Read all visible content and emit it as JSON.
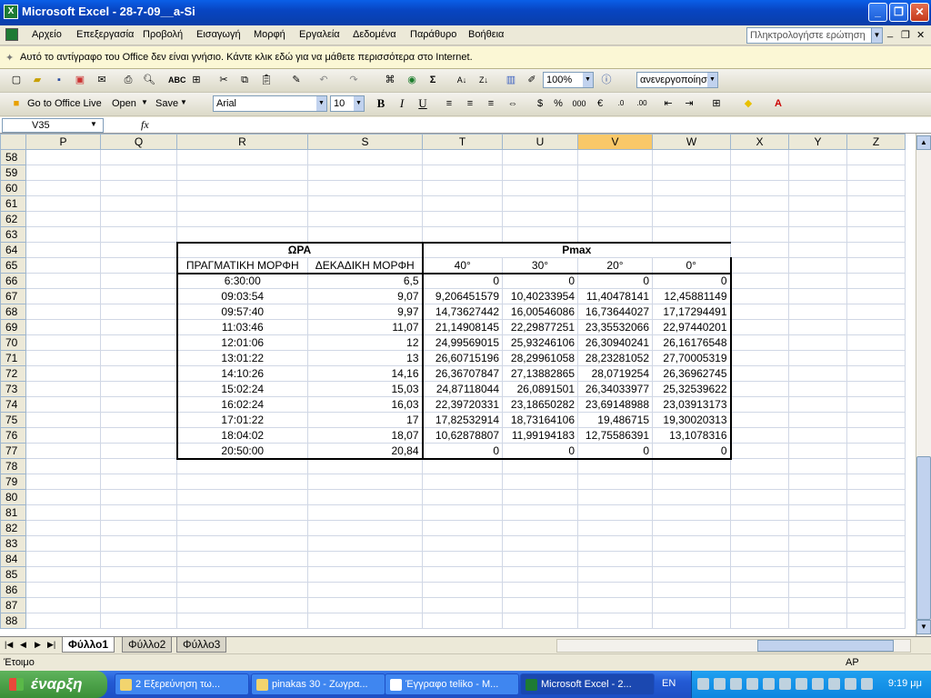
{
  "window": {
    "title": "Microsoft Excel - 28-7-09__a-Si",
    "app_icon": "excel-icon"
  },
  "menu": {
    "items": [
      "Αρχείο",
      "Επεξεργασία",
      "Προβολή",
      "Εισαγωγή",
      "Μορφή",
      "Εργαλεία",
      "Δεδομένα",
      "Παράθυρο",
      "Βοήθεια"
    ],
    "help_placeholder": "Πληκτρολογήστε ερώτηση"
  },
  "infobar": {
    "text": "Αυτό το αντίγραφο του Office δεν είναι γνήσιο. Κάντε κλικ εδώ για να μάθετε περισσότερα στο Internet."
  },
  "toolbar": {
    "zoom": "100%",
    "research": "ανενεργοποίησ",
    "go_office_live": "Go to Office Live",
    "open": "Open",
    "save": "Save",
    "font": "Arial",
    "font_size": "10"
  },
  "formula_bar": {
    "name_box": "V35",
    "fx": "fx",
    "content": ""
  },
  "columns": [
    "P",
    "Q",
    "R",
    "S",
    "T",
    "U",
    "V",
    "W",
    "X",
    "Y",
    "Z"
  ],
  "selected_column": "V",
  "rows": [
    {
      "n": "58",
      "cells": [
        "",
        "",
        "",
        "",
        "",
        "",
        "",
        "",
        "",
        "",
        ""
      ]
    },
    {
      "n": "59",
      "cells": [
        "",
        "",
        "",
        "",
        "",
        "",
        "",
        "",
        "",
        "",
        ""
      ]
    },
    {
      "n": "60",
      "cells": [
        "",
        "",
        "",
        "",
        "",
        "",
        "",
        "",
        "",
        "",
        ""
      ]
    },
    {
      "n": "61",
      "cells": [
        "",
        "",
        "",
        "",
        "",
        "",
        "",
        "",
        "",
        "",
        ""
      ]
    },
    {
      "n": "62",
      "cells": [
        "",
        "",
        "",
        "",
        "",
        "",
        "",
        "",
        "",
        "",
        ""
      ]
    },
    {
      "n": "63",
      "cells": [
        "",
        "",
        "",
        "",
        "",
        "",
        "",
        "",
        "",
        "",
        ""
      ]
    },
    {
      "n": "64",
      "cells": [
        "",
        "",
        "ΩΡΑ",
        "",
        "Pmax",
        "",
        "",
        "",
        "",
        "",
        ""
      ]
    },
    {
      "n": "65",
      "cells": [
        "",
        "",
        "ΠΡΑΓΜΑΤΙΚΗ ΜΟΡΦΗ",
        "ΔΕΚΑΔΙΚΗ ΜΟΡΦΗ",
        "40°",
        "30°",
        "20°",
        "0°",
        "",
        "",
        ""
      ]
    },
    {
      "n": "66",
      "cells": [
        "",
        "",
        "6:30:00",
        "6,5",
        "0",
        "0",
        "0",
        "0",
        "",
        "",
        ""
      ]
    },
    {
      "n": "67",
      "cells": [
        "",
        "",
        "09:03:54",
        "9,07",
        "9,206451579",
        "10,40233954",
        "11,40478141",
        "12,45881149",
        "",
        "",
        ""
      ]
    },
    {
      "n": "68",
      "cells": [
        "",
        "",
        "09:57:40",
        "9,97",
        "14,73627442",
        "16,00546086",
        "16,73644027",
        "17,17294491",
        "",
        "",
        ""
      ]
    },
    {
      "n": "69",
      "cells": [
        "",
        "",
        "11:03:46",
        "11,07",
        "21,14908145",
        "22,29877251",
        "23,35532066",
        "22,97440201",
        "",
        "",
        ""
      ]
    },
    {
      "n": "70",
      "cells": [
        "",
        "",
        "12:01:06",
        "12",
        "24,99569015",
        "25,93246106",
        "26,30940241",
        "26,16176548",
        "",
        "",
        ""
      ]
    },
    {
      "n": "71",
      "cells": [
        "",
        "",
        "13:01:22",
        "13",
        "26,60715196",
        "28,29961058",
        "28,23281052",
        "27,70005319",
        "",
        "",
        ""
      ]
    },
    {
      "n": "72",
      "cells": [
        "",
        "",
        "14:10:26",
        "14,16",
        "26,36707847",
        "27,13882865",
        "28,0719254",
        "26,36962745",
        "",
        "",
        ""
      ]
    },
    {
      "n": "73",
      "cells": [
        "",
        "",
        "15:02:24",
        "15,03",
        "24,87118044",
        "26,0891501",
        "26,34033977",
        "25,32539622",
        "",
        "",
        ""
      ]
    },
    {
      "n": "74",
      "cells": [
        "",
        "",
        "16:02:24",
        "16,03",
        "22,39720331",
        "23,18650282",
        "23,69148988",
        "23,03913173",
        "",
        "",
        ""
      ]
    },
    {
      "n": "75",
      "cells": [
        "",
        "",
        "17:01:22",
        "17",
        "17,82532914",
        "18,73164106",
        "19,486715",
        "19,30020313",
        "",
        "",
        ""
      ]
    },
    {
      "n": "76",
      "cells": [
        "",
        "",
        "18:04:02",
        "18,07",
        "10,62878807",
        "11,99194183",
        "12,75586391",
        "13,1078316",
        "",
        "",
        ""
      ]
    },
    {
      "n": "77",
      "cells": [
        "",
        "",
        "20:50:00",
        "20,84",
        "0",
        "0",
        "0",
        "0",
        "",
        "",
        ""
      ]
    },
    {
      "n": "78",
      "cells": [
        "",
        "",
        "",
        "",
        "",
        "",
        "",
        "",
        "",
        "",
        ""
      ]
    },
    {
      "n": "79",
      "cells": [
        "",
        "",
        "",
        "",
        "",
        "",
        "",
        "",
        "",
        "",
        ""
      ]
    },
    {
      "n": "80",
      "cells": [
        "",
        "",
        "",
        "",
        "",
        "",
        "",
        "",
        "",
        "",
        ""
      ]
    },
    {
      "n": "81",
      "cells": [
        "",
        "",
        "",
        "",
        "",
        "",
        "",
        "",
        "",
        "",
        ""
      ]
    },
    {
      "n": "82",
      "cells": [
        "",
        "",
        "",
        "",
        "",
        "",
        "",
        "",
        "",
        "",
        ""
      ]
    },
    {
      "n": "83",
      "cells": [
        "",
        "",
        "",
        "",
        "",
        "",
        "",
        "",
        "",
        "",
        ""
      ]
    },
    {
      "n": "84",
      "cells": [
        "",
        "",
        "",
        "",
        "",
        "",
        "",
        "",
        "",
        "",
        ""
      ]
    },
    {
      "n": "85",
      "cells": [
        "",
        "",
        "",
        "",
        "",
        "",
        "",
        "",
        "",
        "",
        ""
      ]
    },
    {
      "n": "86",
      "cells": [
        "",
        "",
        "",
        "",
        "",
        "",
        "",
        "",
        "",
        "",
        ""
      ]
    },
    {
      "n": "87",
      "cells": [
        "",
        "",
        "",
        "",
        "",
        "",
        "",
        "",
        "",
        "",
        ""
      ]
    },
    {
      "n": "88",
      "cells": [
        "",
        "",
        "",
        "",
        "",
        "",
        "",
        "",
        "",
        "",
        ""
      ]
    }
  ],
  "sheets": [
    {
      "label": "Φύλλο1",
      "active": true
    },
    {
      "label": "Φύλλο2",
      "active": false
    },
    {
      "label": "Φύλλο3",
      "active": false
    }
  ],
  "status": {
    "ready": "Έτοιμο",
    "mode": "AP"
  },
  "taskbar": {
    "start": "έναρξη",
    "tasks": [
      {
        "label": "2 Εξερεύνηση τω...",
        "active": false
      },
      {
        "label": "pinakas 30 - Ζωγρα...",
        "active": false
      },
      {
        "label": "Έγγραφο teliko - M...",
        "active": false
      },
      {
        "label": "Microsoft Excel - 2...",
        "active": true
      }
    ],
    "lang": "EN",
    "clock": "9:19 μμ"
  }
}
